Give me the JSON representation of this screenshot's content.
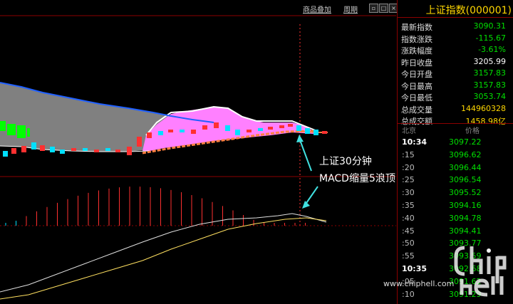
{
  "toolbar": {
    "overlay_label": "商品叠加",
    "period_label": "周期"
  },
  "panel": {
    "title": "上证指数(000001)",
    "quotes": [
      {
        "label": "最新指数",
        "value": "3090.31",
        "color": "#00e000"
      },
      {
        "label": "指数涨跌",
        "value": "-115.67",
        "color": "#00e000"
      },
      {
        "label": "涨跌幅度",
        "value": "-3.61%",
        "color": "#00e000"
      },
      {
        "label": "昨日收盘",
        "value": "3205.99",
        "color": "#ffffff"
      },
      {
        "label": "今日开盘",
        "value": "3157.83",
        "color": "#00e000"
      },
      {
        "label": "今日最高",
        "value": "3157.83",
        "color": "#00e000"
      },
      {
        "label": "今日最低",
        "value": "3053.74",
        "color": "#00e000"
      },
      {
        "label": "总成交量",
        "value": "144960328",
        "color": "#ffd700"
      },
      {
        "label": "总成交额",
        "value": "1458.98亿",
        "color": "#ffd700"
      }
    ],
    "ticks_header": {
      "left": "北京",
      "right": "价格"
    },
    "ticks": [
      {
        "time": "10:34",
        "price": "3097.22",
        "big": true
      },
      {
        "time": ":15",
        "price": "3096.62",
        "big": false
      },
      {
        "time": ":20",
        "price": "3096.44",
        "big": false
      },
      {
        "time": ":25",
        "price": "3096.54",
        "big": false
      },
      {
        "time": ":30",
        "price": "3095.52",
        "big": false
      },
      {
        "time": ":35",
        "price": "3094.16",
        "big": false
      },
      {
        "time": ":40",
        "price": "3094.78",
        "big": false
      },
      {
        "time": ":45",
        "price": "3094.41",
        "big": false
      },
      {
        "time": ":50",
        "price": "3093.77",
        "big": false
      },
      {
        "time": ":55",
        "price": "3093.59",
        "big": false
      },
      {
        "time": "10:35",
        "price": "3092.68",
        "big": true
      },
      {
        "time": ":05",
        "price": "3091.62",
        "big": false
      },
      {
        "time": ":10",
        "price": "3091.29",
        "big": false
      }
    ]
  },
  "annotation": {
    "line1": "上证30分钟",
    "line2": "MACD缩量5浪顶"
  },
  "watermark": {
    "text": "www.chiphell.com",
    "logo": "chiphell-logo"
  },
  "colors": {
    "up": "#ff3030",
    "down": "#00e0ff",
    "pink_band": "#ff80ff",
    "gray_band": "#808080",
    "blue_line": "#2060ff",
    "orange_line": "#ff8040",
    "green_bars": "#00ff00",
    "grid_red": "#8b0000",
    "macd_white": "#e0e0e0",
    "macd_yellow": "#ffe060"
  }
}
